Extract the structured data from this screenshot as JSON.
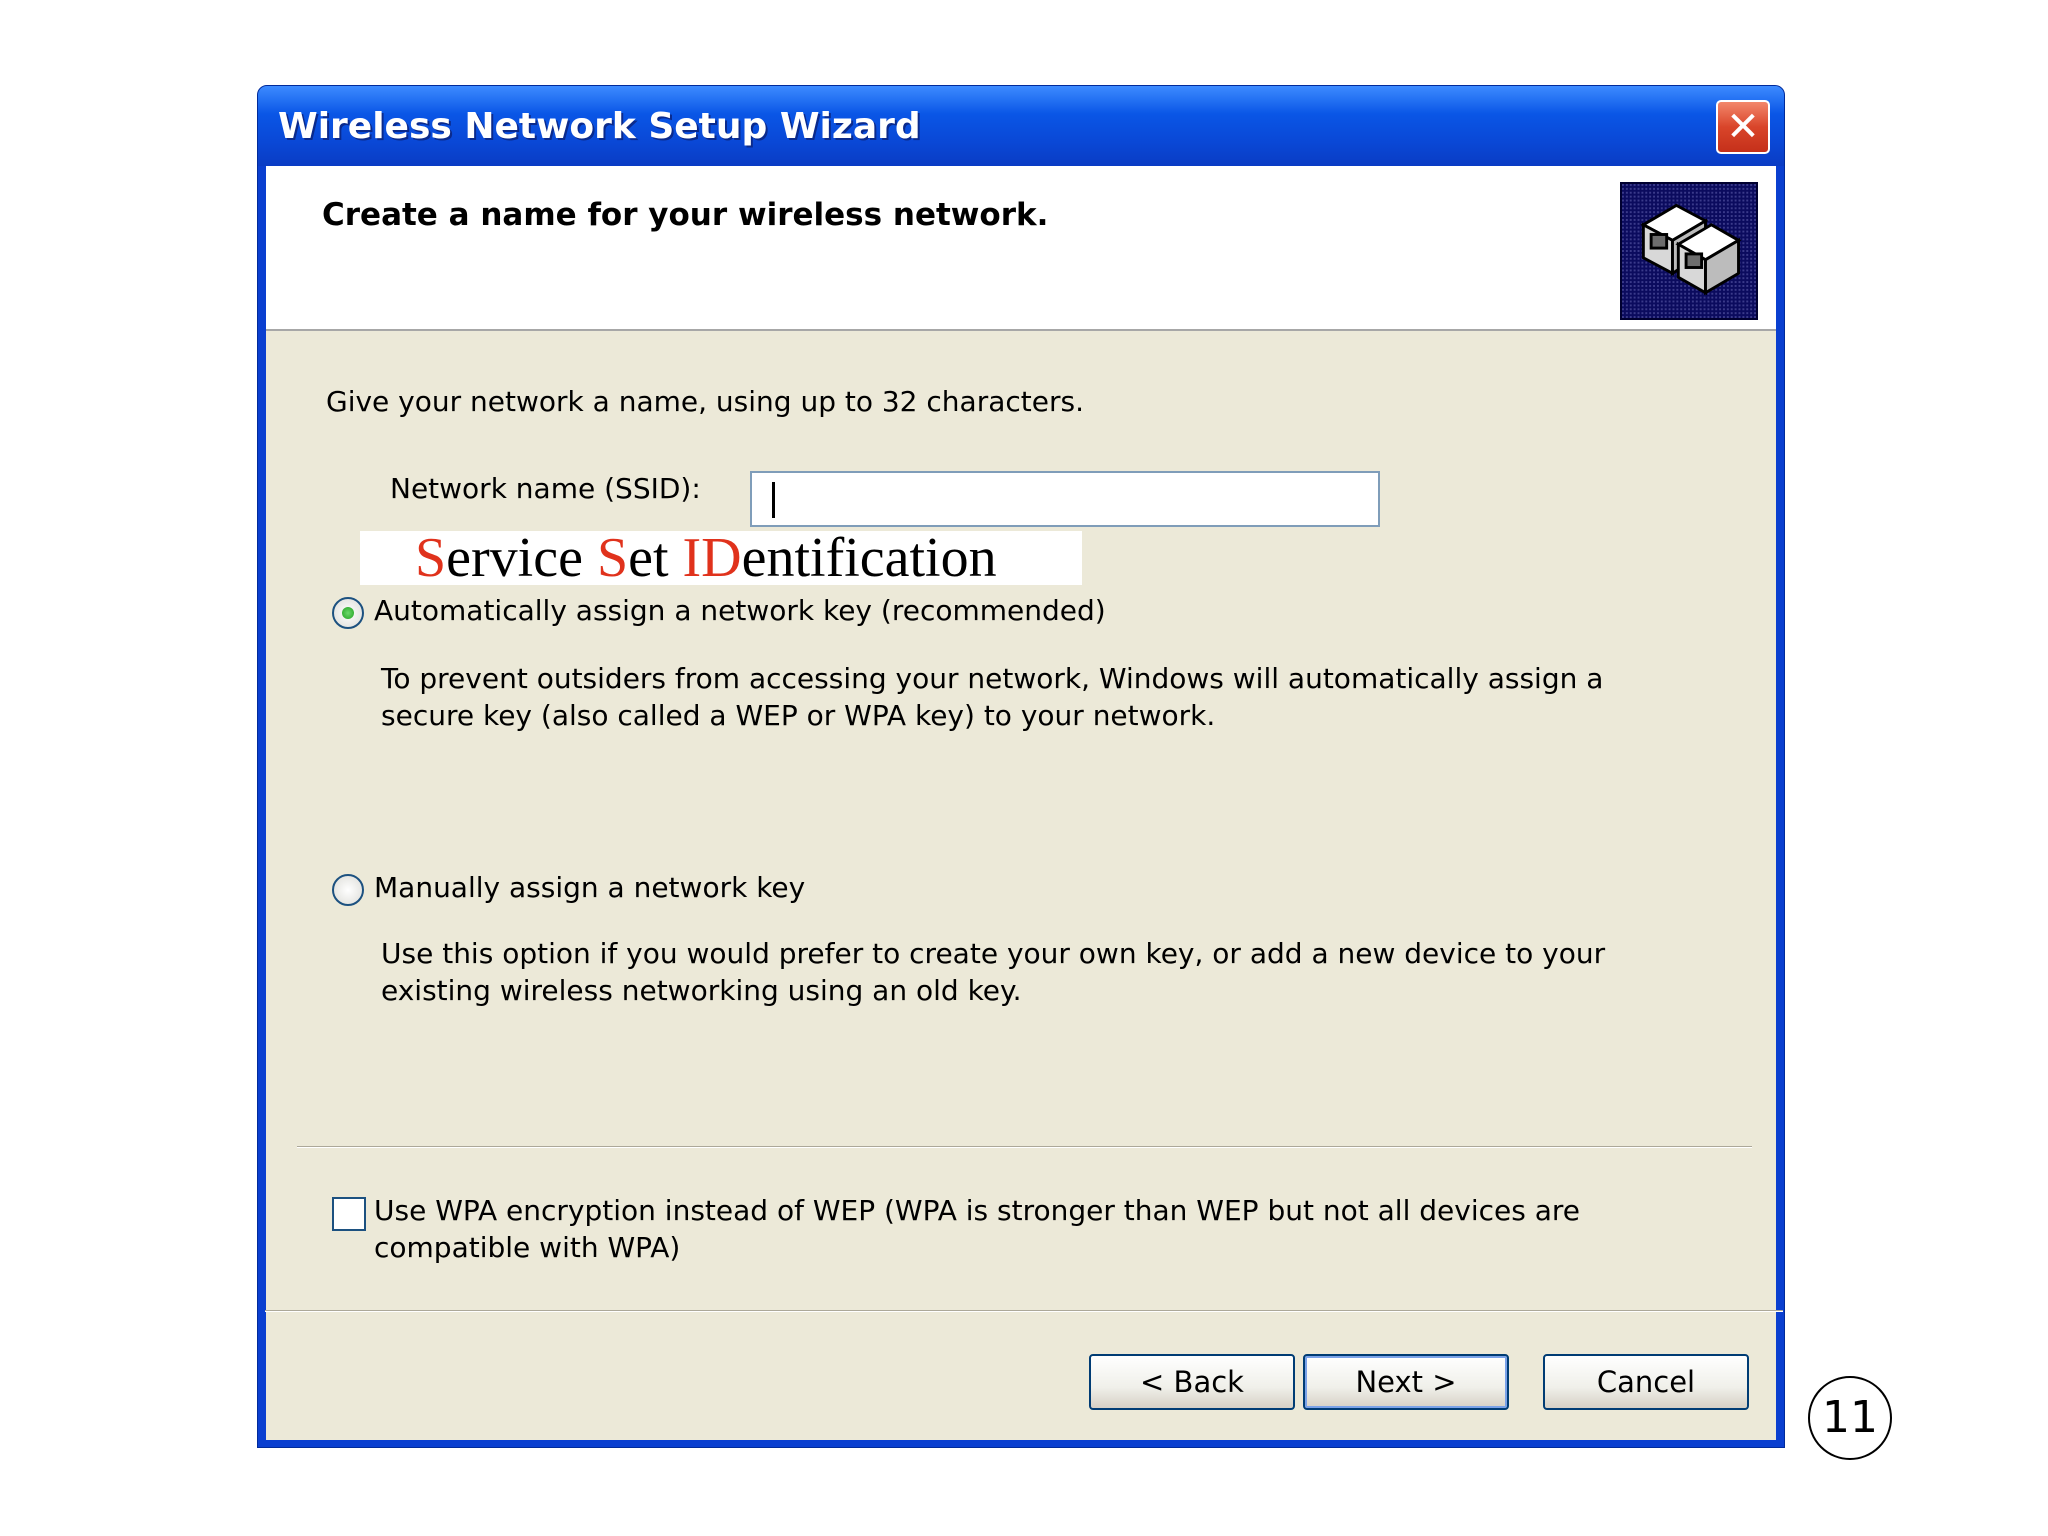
{
  "window": {
    "title": "Wireless Network Setup Wizard",
    "close_glyph": "✕"
  },
  "header": {
    "title": "Create a name for your wireless network.",
    "icon": "network-computers-icon"
  },
  "intro": "Give your network a name, using up to 32 characters.",
  "ssid": {
    "label": "Network name (SSID):",
    "value": "",
    "placeholder": ""
  },
  "annotation": {
    "parts": [
      {
        "text": "S",
        "color": "#e0321c"
      },
      {
        "text": "ervice ",
        "color": "#000000"
      },
      {
        "text": "S",
        "color": "#e0321c"
      },
      {
        "text": "et ",
        "color": "#000000"
      },
      {
        "text": "ID",
        "color": "#e0321c"
      },
      {
        "text": "entification",
        "color": "#000000"
      }
    ]
  },
  "options": {
    "auto": {
      "label": "Automatically assign a network key (recommended)",
      "selected": true,
      "desc_line1": "To prevent outsiders from accessing your network, Windows will automatically assign a",
      "desc_line2": "secure key (also called a WEP or WPA key) to your network."
    },
    "manual": {
      "label": "Manually assign a network key",
      "selected": false,
      "desc_line1": "Use this option if you would prefer to create your own key, or add a new device to your",
      "desc_line2": "existing wireless networking using an old key."
    }
  },
  "wpa": {
    "checked": false,
    "line1": "Use WPA encryption instead of WEP (WPA is stronger than WEP but not all devices are",
    "line2": "compatible with WPA)"
  },
  "buttons": {
    "back": "< Back",
    "next": "Next >",
    "cancel": "Cancel"
  },
  "page_number": "11",
  "colors": {
    "title_bar": "#0a56e6",
    "annotation_red": "#e0321c",
    "dialog_bg": "#ece9d8"
  }
}
